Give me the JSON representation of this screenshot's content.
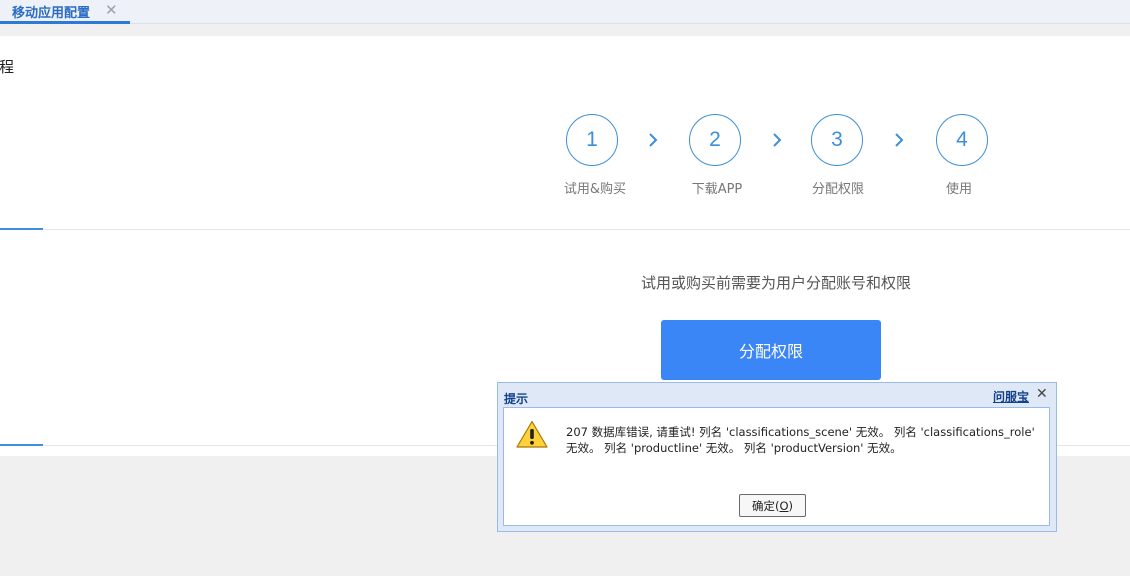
{
  "tabbar": {
    "tab_label": "移动应用配置",
    "tab_close": "✕"
  },
  "content": {
    "section_title": "流程",
    "steps": [
      {
        "number": "1",
        "label": "试用&购买"
      },
      {
        "number": "2",
        "label": "下载APP"
      },
      {
        "number": "3",
        "label": "分配权限"
      },
      {
        "number": "4",
        "label": "使用"
      }
    ],
    "hint": "试用或购买前需要为用户分配账号和权限",
    "assign_button_label": "分配权限"
  },
  "dialog": {
    "title": "提示",
    "help_link": "问服宝",
    "close_glyph": "✕",
    "message": "207 数据库错误, 请重试! 列名 'classifications_scene' 无效。 列名 'classifications_role' 无效。 列名 'productline' 无效。 列名 'productVersion' 无效。",
    "ok_label": "确定",
    "ok_shortcut_open": "(",
    "ok_shortcut": "O",
    "ok_shortcut_close": ")"
  },
  "icons": {
    "step_arrow": "chevron-right-icon",
    "warning": "warning-icon"
  },
  "colors": {
    "accent": "#3d8fd9",
    "primary_button": "#3b86f7",
    "dialog_title": "#15428b"
  }
}
